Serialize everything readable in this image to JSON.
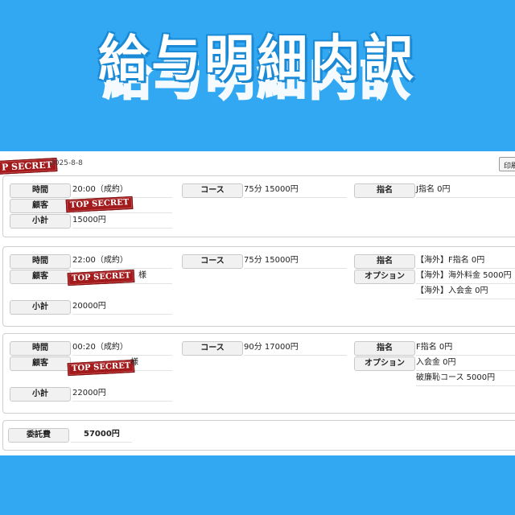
{
  "title": "給与明細内訳",
  "header": {
    "stamp": "TOP SECRET",
    "stamp_partial": "P SECRET",
    "date": "2025-8-8",
    "print_label": "印刷"
  },
  "labels": {
    "time": "時間",
    "customer": "顧客",
    "subtotal": "小計",
    "course": "コース",
    "nomination": "指名",
    "option": "オプション",
    "commission": "委託費"
  },
  "entries": [
    {
      "time": "20:00（成約）",
      "customer_suffix": "",
      "course": "75分 15000円",
      "nomination": "J指名 0円",
      "options": [],
      "subtotal": "15000円"
    },
    {
      "time": "22:00（成約）",
      "customer_suffix": "様",
      "course": "75分 15000円",
      "nomination": "【海外】F指名 0円",
      "options": [
        "【海外】海外料金 5000円",
        "【海外】入会金 0円"
      ],
      "subtotal": "20000円"
    },
    {
      "time": "00:20（成約）",
      "customer_suffix": "様",
      "course": "90分 17000円",
      "nomination": "F指名 0円",
      "options": [
        "入会金 0円",
        "破廉恥コース 5000円"
      ],
      "subtotal": "22000円"
    }
  ],
  "commission_total": "57000円",
  "colors": {
    "background": "#31a8f1",
    "stamp": "#a21a1c",
    "panel": "#ffffff"
  }
}
